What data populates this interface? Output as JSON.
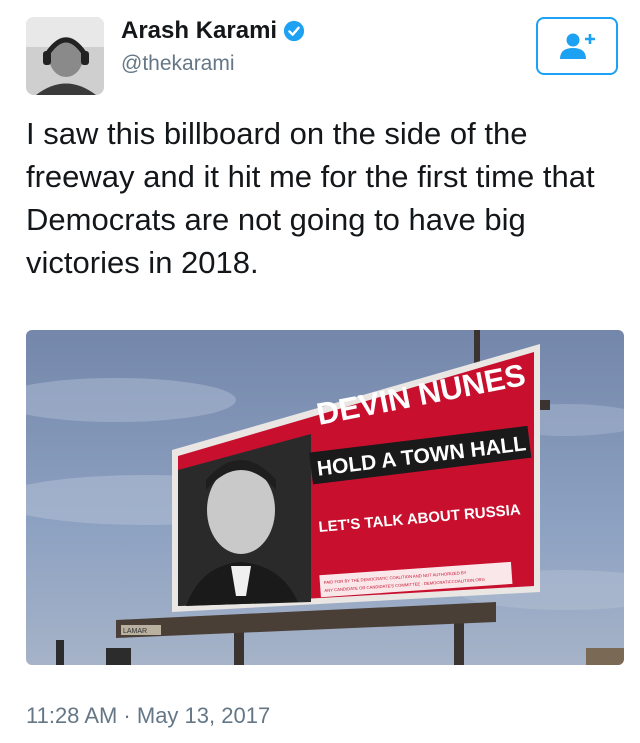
{
  "tweet": {
    "author": {
      "display_name": "Arash Karami",
      "handle": "@thekarami",
      "verified": true,
      "avatar_icon": "person-with-headphones-photo"
    },
    "follow_button": {
      "icon": "add-user-icon"
    },
    "text": "I saw this billboard on the side of the\nfreeway and it hit me for the first time that\nDemocrats are not going to have big\nvictories in 2018.",
    "timestamp": "11:28 AM · May 13, 2017"
  },
  "media": {
    "billboard": {
      "headline": "DEVIN NUNES",
      "banner": "HOLD A TOWN HALL",
      "subline": "LET'S TALK ABOUT RUSSIA",
      "disclaimer_line1": "PAID FOR BY THE DEMOCRATIC COALITION AND NOT AUTHORIZED BY",
      "disclaimer_line2": "ANY CANDIDATE OR CANDIDATE'S COMMITTEE · DEMOCRATICCOALITION.ORG",
      "operator_label": "LAMAR"
    }
  },
  "colors": {
    "accent": "#1da1f2",
    "billboard_red": "#c8102e",
    "sky": "#7f95b8"
  }
}
